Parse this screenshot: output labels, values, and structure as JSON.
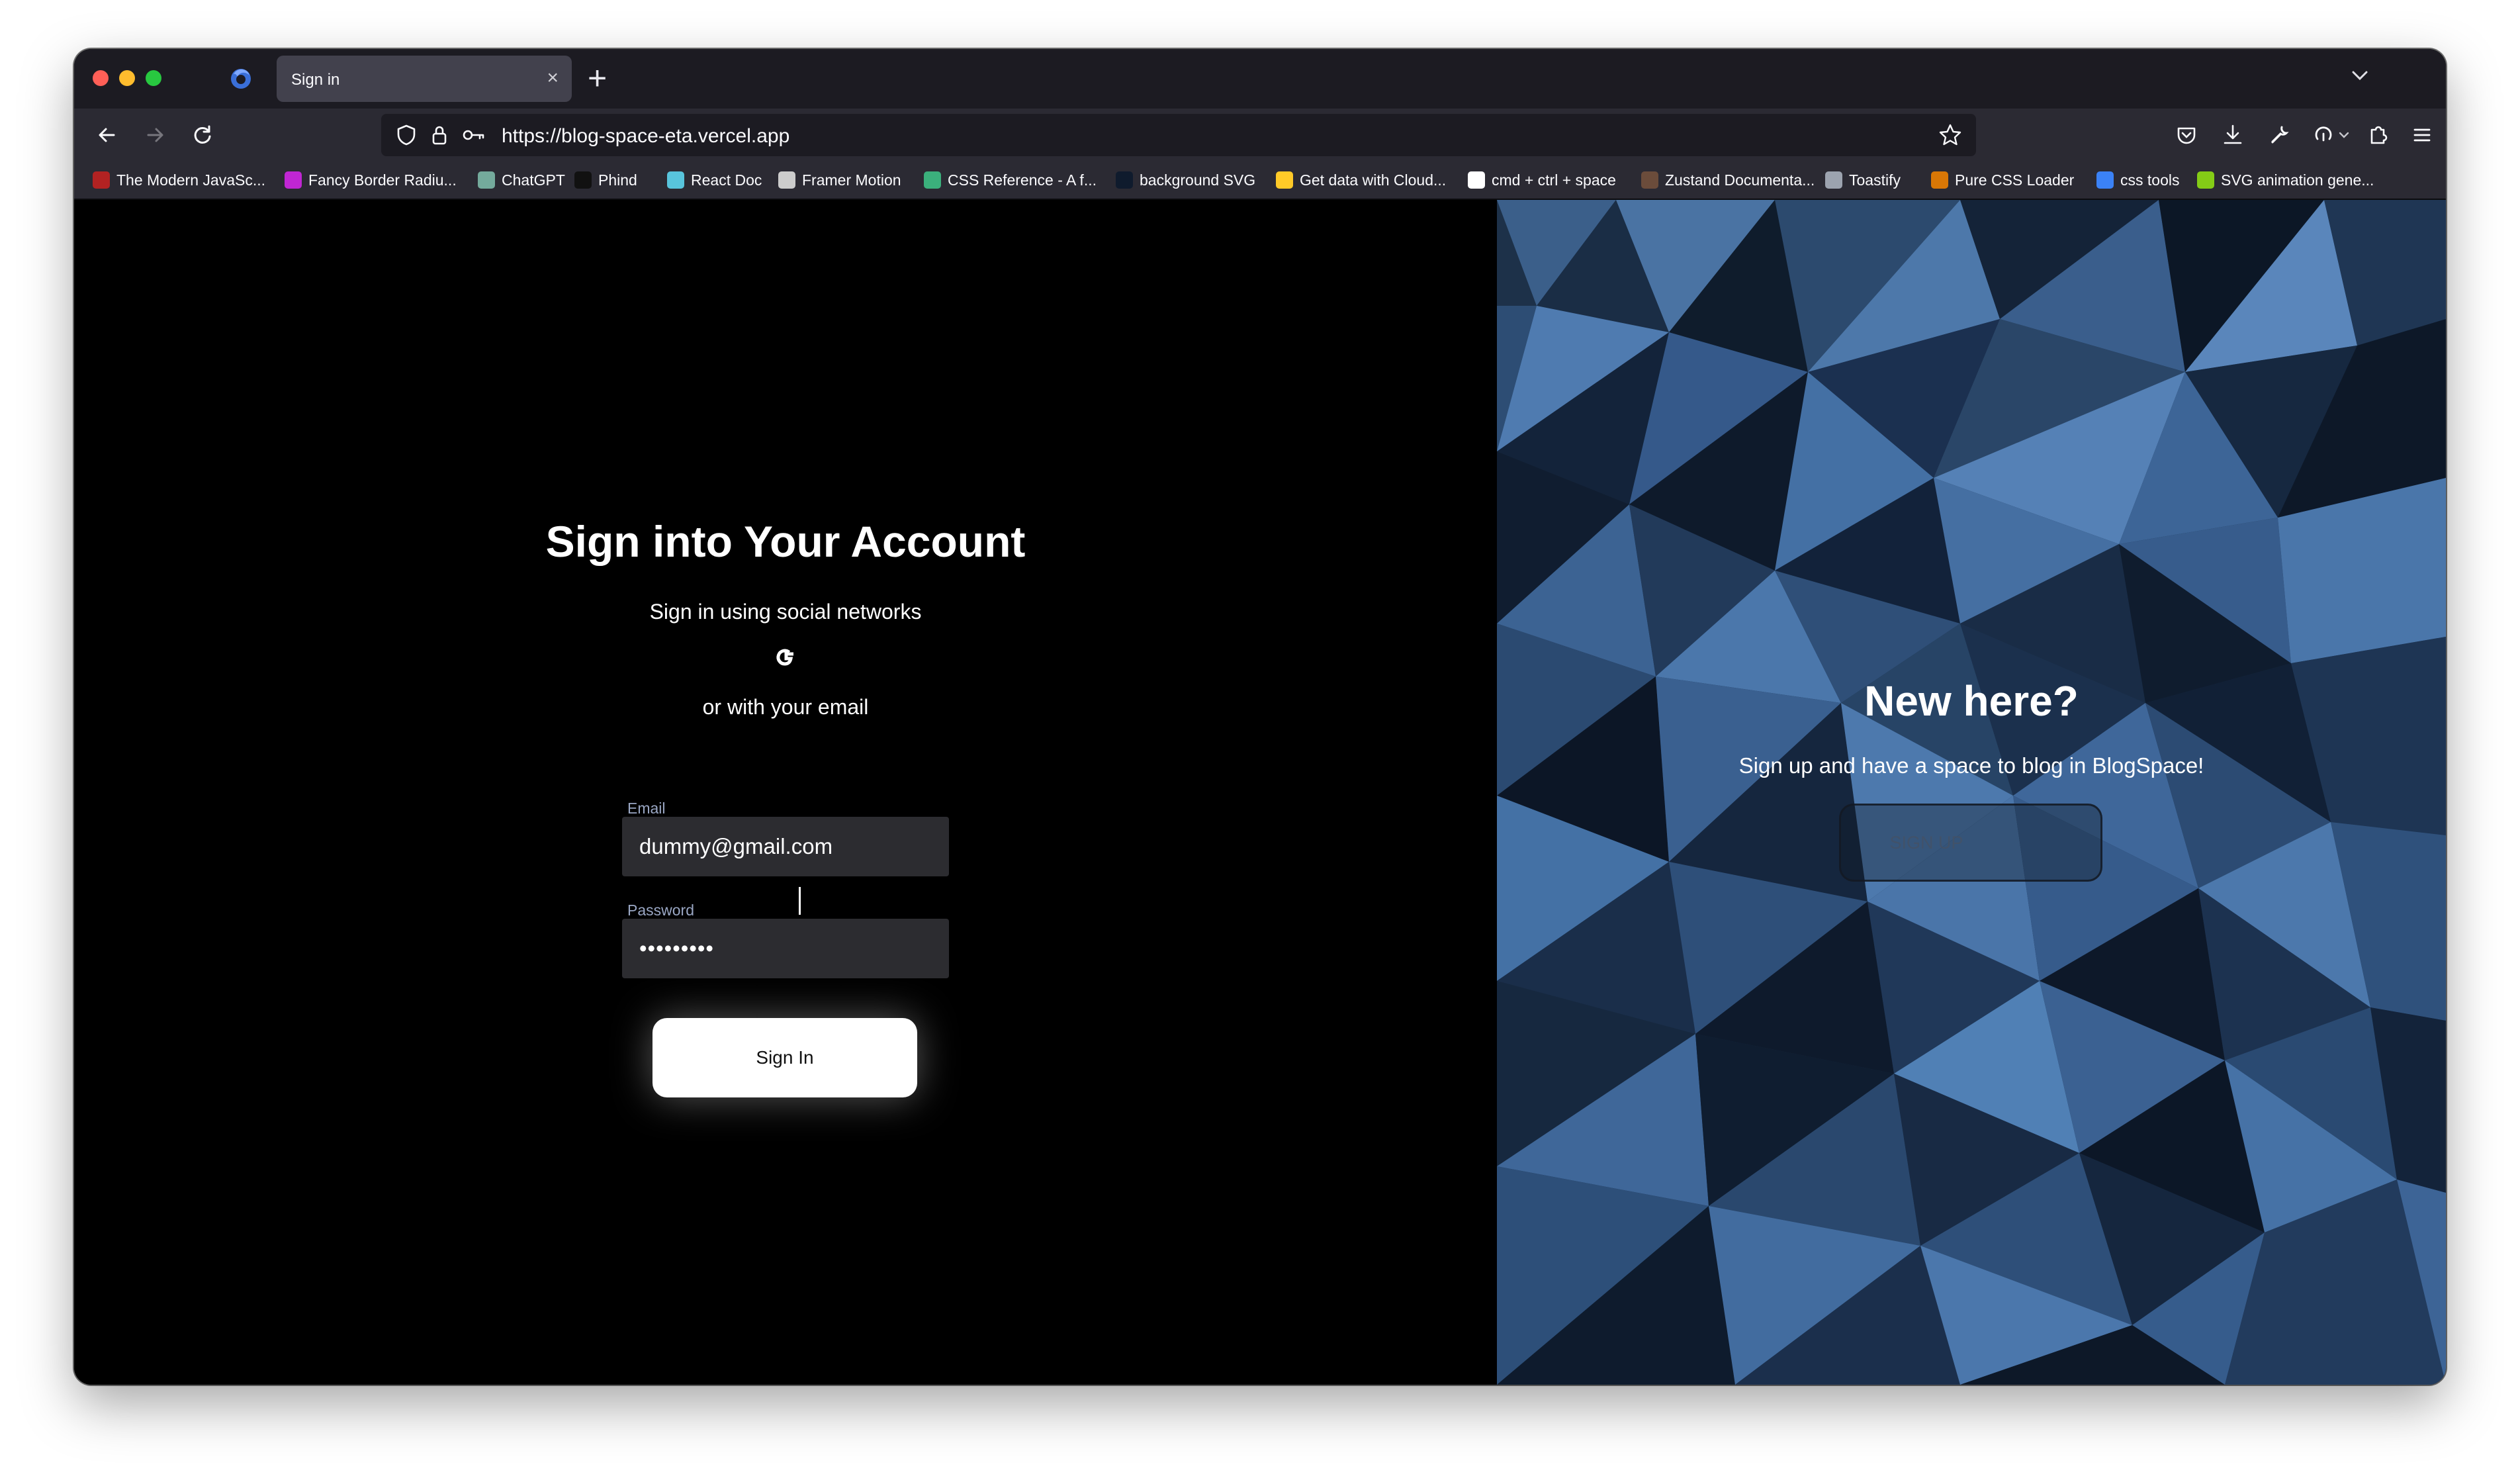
{
  "browser": {
    "tab_title": "Sign in",
    "tab_close": "×",
    "new_tab": "+",
    "url": "https://blog-space-eta.vercel.app",
    "bookmarks": [
      {
        "label": "The Modern JavaSc...",
        "icon": "js-info-icon",
        "color": "#b22222"
      },
      {
        "label": "Fancy Border Radiu...",
        "icon": "fancy-border-icon",
        "color": "#c026d3"
      },
      {
        "label": "ChatGPT",
        "icon": "chatgpt-icon",
        "color": "#74aa9c"
      },
      {
        "label": "Phind",
        "icon": "phind-icon",
        "color": "#111111"
      },
      {
        "label": "React Doc",
        "icon": "react-icon",
        "color": "#58c4dc"
      },
      {
        "label": "Framer Motion",
        "icon": "globe-icon",
        "color": "#cccccc"
      },
      {
        "label": "CSS Reference - A f...",
        "icon": "css-reference-icon",
        "color": "#3bb07c"
      },
      {
        "label": "background SVG",
        "icon": "background-svg-icon",
        "color": "#0f1b2d"
      },
      {
        "label": "Get data with Cloud...",
        "icon": "firebase-icon",
        "color": "#ffca28"
      },
      {
        "label": "cmd + ctrl + space",
        "icon": "google-icon",
        "color": "#ffffff"
      },
      {
        "label": "Zustand Documenta...",
        "icon": "zustand-icon",
        "color": "#6b4c3b"
      },
      {
        "label": "Toastify",
        "icon": "toastify-icon",
        "color": "#9ca3af"
      },
      {
        "label": "Pure CSS Loader",
        "icon": "css-loader-icon",
        "color": "#d97706"
      },
      {
        "label": "css tools",
        "icon": "css-tools-icon",
        "color": "#3b82f6"
      },
      {
        "label": "SVG animation gene...",
        "icon": "svg-animation-icon",
        "color": "#84cc16"
      }
    ]
  },
  "signin": {
    "title": "Sign into Your Account",
    "social_text": "Sign in using social networks",
    "or_text": "or with your email",
    "email_label": "Email",
    "email_value": "dummy@gmail.com",
    "password_label": "Password",
    "password_value": "•••••••••",
    "button_label": "Sign In"
  },
  "signup": {
    "title": "New here?",
    "text": "Sign up and have a space to blog in BlogSpace!",
    "button_label": "SIGN UP"
  },
  "colors": {
    "left_bg": "#000000",
    "right_bg": "#1d3149",
    "accent_label": "#9aa7c4"
  }
}
